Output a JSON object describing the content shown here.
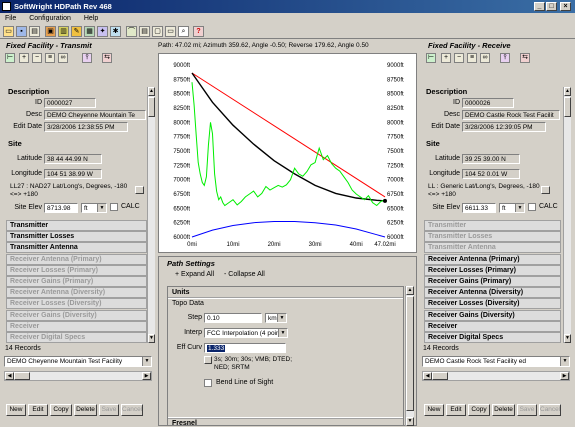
{
  "window": {
    "title": "SoftWright HDPath Rev 468"
  },
  "menu": [
    "File",
    "Configuration",
    "Help"
  ],
  "toolbar_icons": [
    "open-icon",
    "save-icon",
    "print-icon",
    "copy-icon",
    "edit-icon",
    "settings-icon",
    "tools-icon",
    "map-icon",
    "satellite-icon",
    "path-icon",
    "report-icon",
    "view-icon",
    "page-icon",
    "search-icon",
    "help-icon"
  ],
  "path_info": "Path: 47.02 mi; Azimuth 359.62, Angle -0.50; Reverse 179.62, Angle 0.50",
  "left": {
    "title": "Fixed Facility - Transmit",
    "description_hdr": "Description",
    "id_label": "ID",
    "id_value": "0000027",
    "desc_label": "Desc",
    "desc_value": "DEMO Cheyenne Mountain Te",
    "edit_label": "Edit Date",
    "edit_value": "3/28/2006 12:38:55 PM",
    "site_hdr": "Site",
    "lat_label": "Latitude",
    "lat_value": "38 44 44.99 N",
    "lon_label": "Longitude",
    "lon_value": "104 51 38.99 W",
    "datum_text": "LL27 : NAD27 Lat/Long's, Degrees, -180 <=> +180",
    "elev_label": "Site Elev",
    "elev_value": "8713.98",
    "elev_unit": "ft",
    "calc": "CALC",
    "categories": [
      {
        "label": "Transmitter",
        "enabled": true
      },
      {
        "label": "Transmitter Losses",
        "enabled": true
      },
      {
        "label": "Transmitter Antenna",
        "enabled": true
      },
      {
        "label": "Receiver Antenna (Primary)",
        "enabled": false
      },
      {
        "label": "Receiver Losses (Primary)",
        "enabled": false
      },
      {
        "label": "Receiver Gains (Primary)",
        "enabled": false
      },
      {
        "label": "Receiver Antenna (Diversity)",
        "enabled": false
      },
      {
        "label": "Receiver Losses (Diversity)",
        "enabled": false
      },
      {
        "label": "Receiver Gains (Diversity)",
        "enabled": false
      },
      {
        "label": "Receiver",
        "enabled": false
      },
      {
        "label": "Receiver Digital Specs",
        "enabled": false
      }
    ],
    "records": "14 Records",
    "record_select": "DEMO Cheyenne Mountain Test Facility",
    "buttons": [
      {
        "label": "New",
        "enabled": true
      },
      {
        "label": "Edit",
        "enabled": true
      },
      {
        "label": "Copy",
        "enabled": true
      },
      {
        "label": "Delete",
        "enabled": true
      },
      {
        "label": "Save",
        "enabled": false
      },
      {
        "label": "Cancel",
        "enabled": false
      }
    ]
  },
  "right": {
    "title": "Fixed Facility - Receive",
    "description_hdr": "Description",
    "id_label": "ID",
    "id_value": "0000026",
    "desc_label": "Desc",
    "desc_value": "DEMO Castle Rock Test Facilit",
    "edit_label": "Edit Date",
    "edit_value": "3/28/2006 12:39:05 PM",
    "site_hdr": "Site",
    "lat_label": "Latitude",
    "lat_value": "39 25 39.00 N",
    "lon_label": "Longitude",
    "lon_value": "104 52 0.01 W",
    "datum_text": "LL : Generic Lat/Long's, Degrees, -180 <=> +180",
    "elev_label": "Site Elev",
    "elev_value": "6611.33",
    "elev_unit": "ft",
    "calc": "CALC",
    "categories": [
      {
        "label": "Transmitter",
        "enabled": false
      },
      {
        "label": "Transmitter Losses",
        "enabled": false
      },
      {
        "label": "Transmitter Antenna",
        "enabled": false
      },
      {
        "label": "Receiver Antenna (Primary)",
        "enabled": true
      },
      {
        "label": "Receiver Losses (Primary)",
        "enabled": true
      },
      {
        "label": "Receiver Gains (Primary)",
        "enabled": true
      },
      {
        "label": "Receiver Antenna (Diversity)",
        "enabled": true
      },
      {
        "label": "Receiver Losses (Diversity)",
        "enabled": true
      },
      {
        "label": "Receiver Gains (Diversity)",
        "enabled": true
      },
      {
        "label": "Receiver",
        "enabled": true
      },
      {
        "label": "Receiver Digital Specs",
        "enabled": true
      }
    ],
    "records": "14 Records",
    "record_select": "DEMO Castle Rock Test Facility ed",
    "buttons": [
      {
        "label": "New",
        "enabled": true
      },
      {
        "label": "Edit",
        "enabled": true
      },
      {
        "label": "Copy",
        "enabled": true
      },
      {
        "label": "Delete",
        "enabled": true
      },
      {
        "label": "Save",
        "enabled": false
      },
      {
        "label": "Cancel",
        "enabled": false
      }
    ]
  },
  "path_settings": {
    "title": "Path Settings",
    "expand_all": "+ Expand All",
    "collapse_all": "- Collapse All",
    "units_hdr": "Units",
    "topo_hdr": "Topo Data",
    "step_label": "Step",
    "step_value": "0.10",
    "step_unit": "km",
    "interp_label": "Interp",
    "interp_value": "FCC Interpolation (4 points)",
    "eff_curv_label": "Eff Curv",
    "eff_curv_value": "1.333",
    "data_sources": "3s; 30m; 30s; VMB; DTED; NED; SRTM",
    "bend_label": "Bend Line of Sight",
    "next_hdr": "Fresnel"
  },
  "chart_data": {
    "type": "line",
    "x_ticks": [
      "0mi",
      "10mi",
      "20mi",
      "30mi",
      "40mi",
      "47.02mi"
    ],
    "x_tick_values": [
      0,
      10,
      20,
      30,
      40,
      47.02
    ],
    "y_ticks_left": [
      "9000ft",
      "8750ft",
      "8500ft",
      "8250ft",
      "8000ft",
      "7750ft",
      "7500ft",
      "7250ft",
      "7000ft",
      "6750ft",
      "6500ft",
      "6250ft",
      "6000ft"
    ],
    "y_ticks_right": [
      "9000ft",
      "8750ft",
      "8500ft",
      "8250ft",
      "8000ft",
      "7750ft",
      "7500ft",
      "7250ft",
      "7000ft",
      "6750ft",
      "6500ft",
      "6250ft",
      "6000ft"
    ],
    "ylim": [
      6000,
      9000
    ],
    "xlim": [
      0,
      47.02
    ],
    "series": [
      {
        "color": "#ff0000",
        "x": [
          0,
          47.02
        ],
        "y": [
          8860,
          6700
        ]
      },
      {
        "color": "#000000",
        "x": [
          0,
          5,
          10,
          15,
          20,
          25,
          30,
          35,
          40,
          45,
          47.02
        ],
        "y": [
          8860,
          8350,
          7950,
          7620,
          7330,
          7100,
          6900,
          6760,
          6680,
          6640,
          6630
        ]
      },
      {
        "color": "#0000ff",
        "x": [
          0,
          5,
          10,
          15,
          20,
          25,
          30,
          35,
          40,
          45,
          47.02
        ],
        "y": [
          6000,
          6120,
          6200,
          6250,
          6270,
          6270,
          6250,
          6210,
          6140,
          6040,
          6000
        ]
      },
      {
        "color": "#00ee00",
        "x": [
          0,
          0.5,
          1,
          1.5,
          2,
          2.5,
          3,
          3.5,
          4,
          4.5,
          5,
          5.5,
          6,
          6.5,
          7,
          7.5,
          8,
          9,
          10,
          11,
          12,
          13,
          14,
          15,
          16,
          17,
          18,
          19,
          20,
          21,
          22,
          23,
          24,
          25,
          26,
          27,
          28,
          29,
          30,
          31,
          32,
          33,
          34,
          35,
          36,
          37,
          38,
          39,
          40,
          41,
          42,
          43,
          44,
          45,
          46,
          47.02
        ],
        "y": [
          8700,
          8300,
          7800,
          7300,
          7100,
          6950,
          6900,
          7050,
          7600,
          8000,
          7800,
          7100,
          6800,
          6650,
          6700,
          6600,
          6550,
          6600,
          6650,
          6560,
          6620,
          6700,
          6750,
          6800,
          6700,
          6760,
          6880,
          6820,
          6860,
          6900,
          6870,
          6910,
          7000,
          7200,
          7100,
          7060,
          7140,
          7260,
          7300,
          7550,
          7350,
          7420,
          7280,
          7200,
          7150,
          7050,
          6950,
          6820,
          6750,
          6700,
          6650,
          6720,
          6600,
          6550,
          6620,
          6650
        ]
      }
    ]
  }
}
